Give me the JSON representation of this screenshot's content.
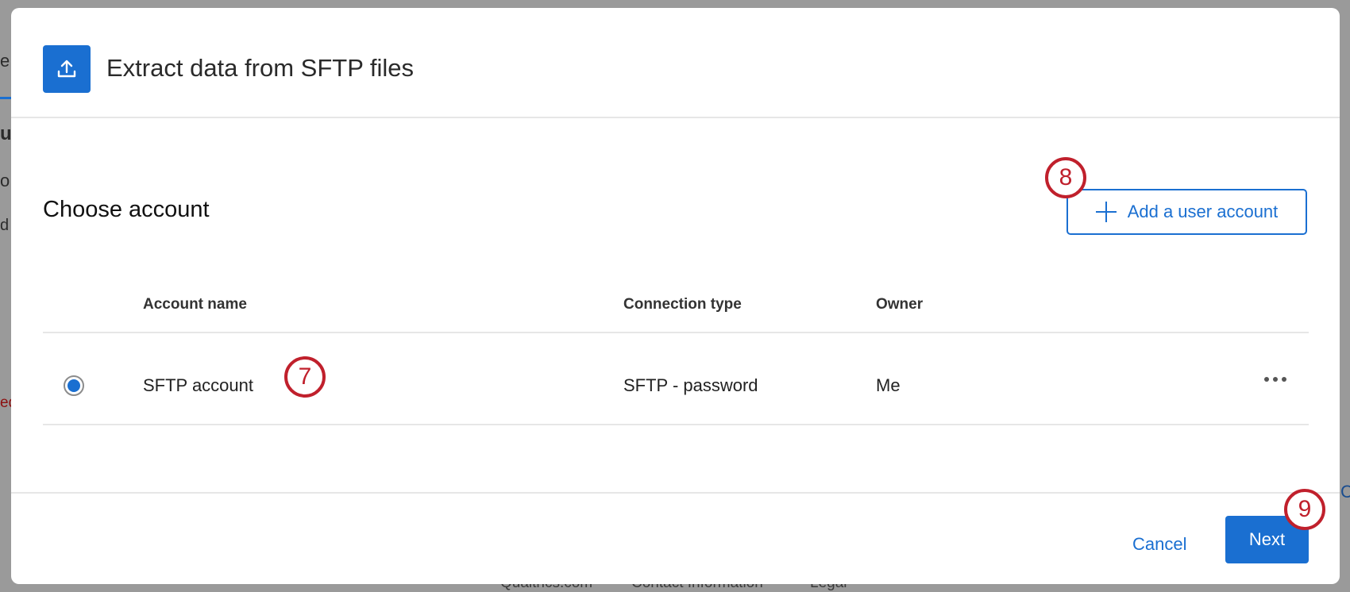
{
  "background": {
    "fragments": [
      "e",
      "ur",
      "o",
      "d",
      "eq",
      "C"
    ],
    "footer_links": [
      "Qualtrics.com",
      "Contact Information",
      "Legal"
    ]
  },
  "modal": {
    "title": "Extract data from SFTP files",
    "header_icon": "upload-icon",
    "section_title": "Choose account",
    "add_button_label": "Add a user account",
    "table": {
      "headers": [
        "Account name",
        "Connection type",
        "Owner"
      ],
      "rows": [
        {
          "account_name": "SFTP account",
          "connection_type": "SFTP - password",
          "owner": "Me",
          "selected": true
        }
      ]
    },
    "cancel_label": "Cancel",
    "next_label": "Next"
  },
  "callouts": {
    "row": "7",
    "add": "8",
    "next": "9"
  },
  "colors": {
    "accent": "#1a6fd1",
    "callout": "#c0202c",
    "overlay": "#9a9a9a"
  }
}
